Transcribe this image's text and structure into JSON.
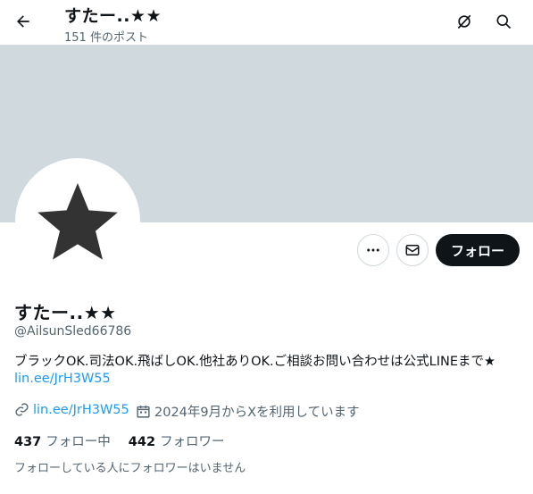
{
  "header": {
    "title": "すたー..★★",
    "post_count": "151 件のポスト"
  },
  "icons": {
    "back": "arrow-left-icon",
    "grok": "grok-icon",
    "search": "search-icon",
    "more": "more-dots-icon",
    "message": "mail-icon",
    "link": "link-icon",
    "calendar": "calendar-icon",
    "avatar": "star-icon"
  },
  "colors": {
    "banner": "#cfd9de",
    "accent": "#1d9bf0",
    "follow_button": "#0f1419",
    "secondary_text": "#536471"
  },
  "profile": {
    "display_name": "すたー..★★",
    "handle": "@AilsunSled66786",
    "bio": "ブラックOK.司法OK.飛ばしOK.他社ありOK.ご相談お問い合わせは公式LINEまで★",
    "bio_link": "lin.ee/JrH3W55",
    "website": "lin.ee/JrH3W55",
    "joined": "2024年9月からXを利用しています",
    "following_count": "437",
    "following_label": "フォロー中",
    "followers_count": "442",
    "followers_label": "フォロワー",
    "followers_you_know": "フォローしている人にフォロワーはいません"
  },
  "actions": {
    "follow_label": "フォロー"
  }
}
